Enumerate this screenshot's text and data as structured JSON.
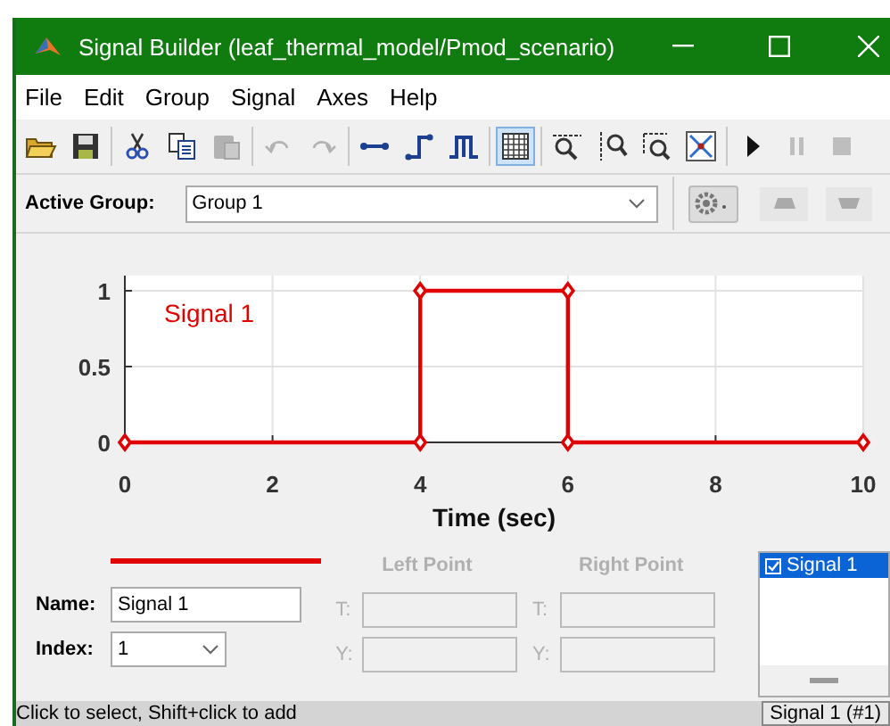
{
  "window": {
    "title": "Signal Builder (leaf_thermal_model/Pmod_scenario)"
  },
  "menu": [
    "File",
    "Edit",
    "Group",
    "Signal",
    "Axes",
    "Help"
  ],
  "toolbar": [
    {
      "kind": "open",
      "disabled": false,
      "selected": false
    },
    {
      "kind": "save",
      "disabled": false,
      "selected": false
    },
    {
      "kind": "sep"
    },
    {
      "kind": "cut",
      "disabled": false,
      "selected": false
    },
    {
      "kind": "copy",
      "disabled": false,
      "selected": false
    },
    {
      "kind": "paste",
      "disabled": true,
      "selected": false
    },
    {
      "kind": "sep"
    },
    {
      "kind": "undo",
      "disabled": true,
      "selected": false
    },
    {
      "kind": "redo",
      "disabled": true,
      "selected": false
    },
    {
      "kind": "sep"
    },
    {
      "kind": "segment",
      "disabled": false,
      "selected": false
    },
    {
      "kind": "step",
      "disabled": false,
      "selected": false
    },
    {
      "kind": "pulse",
      "disabled": false,
      "selected": false
    },
    {
      "kind": "sep"
    },
    {
      "kind": "grid",
      "disabled": false,
      "selected": true
    },
    {
      "kind": "sep"
    },
    {
      "kind": "zoomx",
      "disabled": false,
      "selected": false
    },
    {
      "kind": "zoomy",
      "disabled": false,
      "selected": false
    },
    {
      "kind": "zoomxy",
      "disabled": false,
      "selected": false
    },
    {
      "kind": "fit",
      "disabled": false,
      "selected": false
    },
    {
      "kind": "sep"
    },
    {
      "kind": "play",
      "disabled": false,
      "selected": false
    },
    {
      "kind": "pause",
      "disabled": true,
      "selected": false
    },
    {
      "kind": "stop",
      "disabled": true,
      "selected": false
    }
  ],
  "active_group": {
    "label": "Active Group:",
    "value": "Group 1"
  },
  "chart": {
    "chart_data": {
      "type": "line",
      "xlabel": "Time (sec)",
      "x": [
        0,
        4,
        4,
        6,
        6,
        10
      ],
      "series": [
        {
          "name": "Signal 1",
          "color": "#e00000",
          "marker": "diamond",
          "values": [
            0,
            0,
            1,
            1,
            0,
            0
          ]
        }
      ],
      "grid": true,
      "xlim": [
        0,
        10
      ],
      "ylim": [
        0,
        1.1
      ],
      "xticks": [
        0,
        2,
        4,
        6,
        8,
        10
      ],
      "yticks": [
        0,
        0.5,
        1
      ]
    }
  },
  "editor": {
    "name_label": "Name:",
    "name_value": "Signal 1",
    "index_label": "Index:",
    "index_value": "1",
    "left_point": {
      "title": "Left Point",
      "t_label": "T:",
      "y_label": "Y:"
    },
    "right_point": {
      "title": "Right Point",
      "t_label": "T:",
      "y_label": "Y:"
    }
  },
  "signal_list": [
    {
      "label": "Signal 1",
      "checked": true,
      "selected": true
    }
  ],
  "status_bar": {
    "message": "Click to select, Shift+click to add",
    "signal": "Signal 1 (#1)"
  }
}
